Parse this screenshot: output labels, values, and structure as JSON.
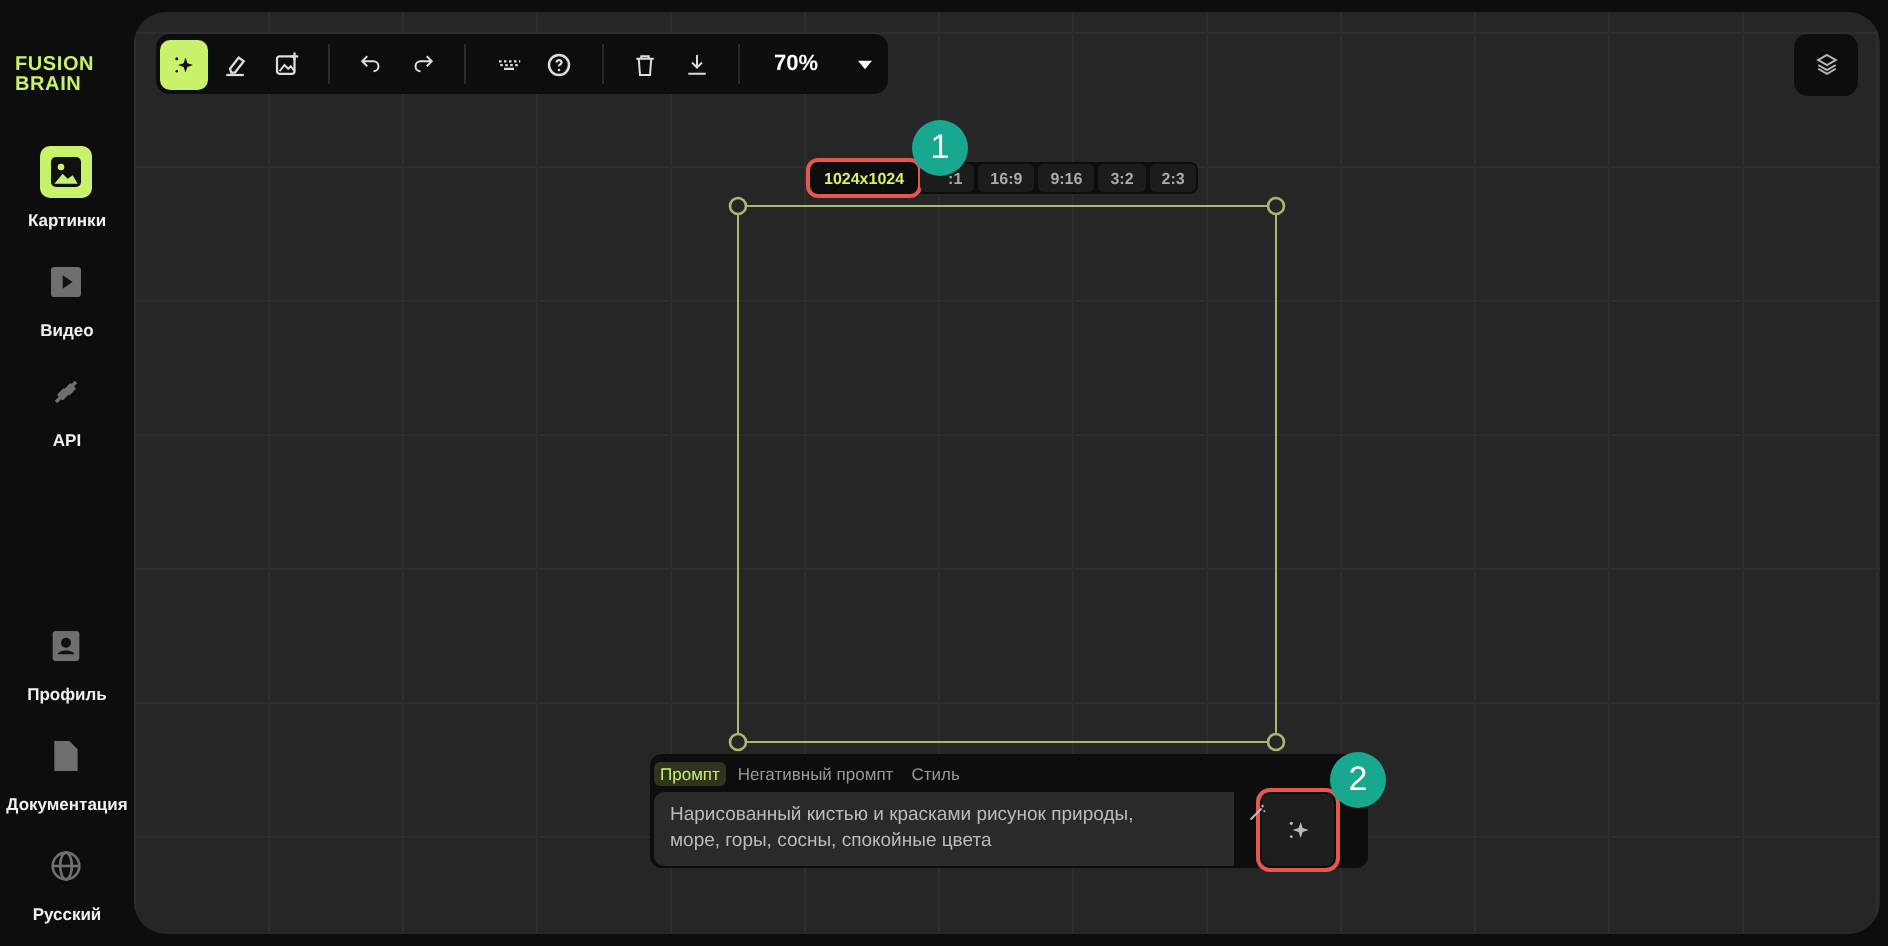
{
  "logo": "FUSION BRAIN",
  "sidebar": {
    "items": [
      {
        "label": "Картинки",
        "selected": true
      },
      {
        "label": "Видео",
        "selected": false
      },
      {
        "label": "API",
        "selected": false
      }
    ],
    "bottom_items": [
      {
        "label": "Профиль"
      },
      {
        "label": "Документация"
      },
      {
        "label": "Русский"
      }
    ]
  },
  "toolbar": {
    "groups": [
      [
        {
          "selected": true
        },
        {
          "selected": false
        },
        {
          "selected": false
        }
      ],
      [
        {
          "selected": false
        },
        {
          "selected": false
        }
      ],
      [
        {
          "selected": false
        },
        {
          "selected": false
        }
      ],
      [
        {
          "selected": false
        },
        {
          "selected": false
        }
      ]
    ],
    "zoom": "70%"
  },
  "ratios": [
    {
      "label": "1024x1024",
      "selected": true
    },
    {
      "label": ":1",
      "selected": false
    },
    {
      "label": "16:9",
      "selected": false
    },
    {
      "label": "9:16",
      "selected": false
    },
    {
      "label": "3:2",
      "selected": false
    },
    {
      "label": "2:3",
      "selected": false
    }
  ],
  "prompt": {
    "tabs": [
      {
        "label": "Промпт",
        "selected": true
      },
      {
        "label": "Негативный промпт",
        "selected": false
      },
      {
        "label": "Стиль",
        "selected": false
      }
    ],
    "value": "Нарисованный кистью и красками рисунок природы, море, горы, сосны, спокойные цвета"
  },
  "annotations": [
    {
      "label": "1"
    },
    {
      "label": "2"
    }
  ]
}
